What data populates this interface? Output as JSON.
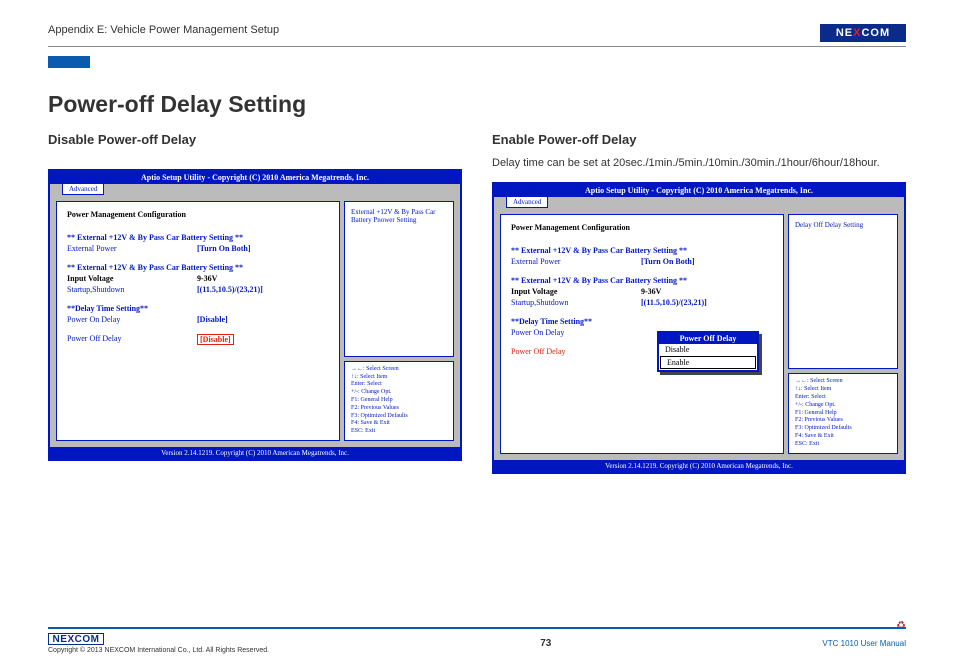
{
  "header": {
    "appendix": "Appendix E: Vehicle Power Management Setup",
    "logo_text": "NE COM",
    "logo_x": "X"
  },
  "page_title": "Power-off Delay Setting",
  "left": {
    "subtitle": "Disable Power-off Delay"
  },
  "right": {
    "subtitle": "Enable Power-off Delay",
    "desc": "Delay time can be set at 20sec./1min./5min./10min./30min./1hour/6hour/18hour."
  },
  "bios": {
    "header": "Aptio Setup Utility - Copyright (C) 2010 America Megatrends, Inc.",
    "tab": "Advanced",
    "footer": "Version 2.14.1219. Copyright (C) 2010 American Megatrends, Inc.",
    "heading": "Power Management Configuration",
    "sec1": "** External +12V & By Pass Car Battery Setting **",
    "ext_power_label": "External Power",
    "ext_power_val": "[Turn On Both]",
    "sec2": "** External +12V & By Pass Car Battery Setting **",
    "input_voltage_label": "Input Voltage",
    "input_voltage_val": "9-36V",
    "startup_label": "Startup,Shutdown",
    "startup_val": "[(11.5,10.5)/(23,21)]",
    "sec3": "**Delay Time Setting**",
    "pon_label": "Power On Delay",
    "pon_val": "[Disable]",
    "poff_label": "Power Off Delay",
    "poff_val": "[Disable]",
    "info_left": "External +12V & By Pass Car Battery Pnower Setting",
    "info_right": "Delay Off Delay Setting",
    "help": {
      "l1": "→←: Select Screen",
      "l2": "↑↓: Select Item",
      "l3": "Enter: Select",
      "l4": "+/-: Change Opt.",
      "l5": "F1: General Help",
      "l6": "F2: Previous Values",
      "l7": "F3: Optimized Defaults",
      "l8": "F4: Save & Exit",
      "l9": "ESC: Exit"
    },
    "popup": {
      "title": "Power Off Delay",
      "opt1": "Disable",
      "opt2": "Enable"
    }
  },
  "footer": {
    "logo": "NEXCOM",
    "copy": "Copyright © 2013 NEXCOM International Co., Ltd. All Rights Reserved.",
    "page": "73",
    "right": "VTC 1010 User Manual"
  }
}
